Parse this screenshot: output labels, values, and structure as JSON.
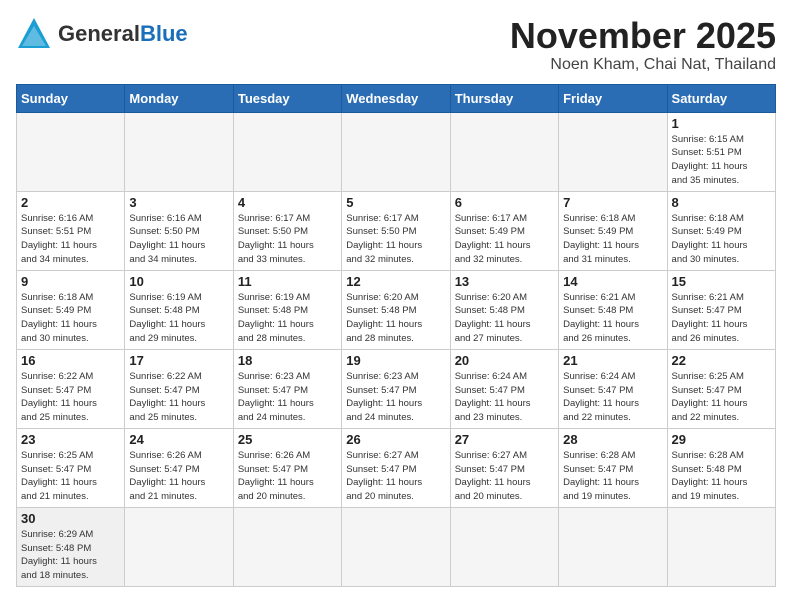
{
  "header": {
    "logo_general": "General",
    "logo_blue": "Blue",
    "month_title": "November 2025",
    "location": "Noen Kham, Chai Nat, Thailand"
  },
  "days_of_week": [
    "Sunday",
    "Monday",
    "Tuesday",
    "Wednesday",
    "Thursday",
    "Friday",
    "Saturday"
  ],
  "weeks": [
    [
      {
        "day": "",
        "info": ""
      },
      {
        "day": "",
        "info": ""
      },
      {
        "day": "",
        "info": ""
      },
      {
        "day": "",
        "info": ""
      },
      {
        "day": "",
        "info": ""
      },
      {
        "day": "",
        "info": ""
      },
      {
        "day": "1",
        "info": "Sunrise: 6:15 AM\nSunset: 5:51 PM\nDaylight: 11 hours\nand 35 minutes."
      }
    ],
    [
      {
        "day": "2",
        "info": "Sunrise: 6:16 AM\nSunset: 5:51 PM\nDaylight: 11 hours\nand 34 minutes."
      },
      {
        "day": "3",
        "info": "Sunrise: 6:16 AM\nSunset: 5:50 PM\nDaylight: 11 hours\nand 34 minutes."
      },
      {
        "day": "4",
        "info": "Sunrise: 6:17 AM\nSunset: 5:50 PM\nDaylight: 11 hours\nand 33 minutes."
      },
      {
        "day": "5",
        "info": "Sunrise: 6:17 AM\nSunset: 5:50 PM\nDaylight: 11 hours\nand 32 minutes."
      },
      {
        "day": "6",
        "info": "Sunrise: 6:17 AM\nSunset: 5:49 PM\nDaylight: 11 hours\nand 32 minutes."
      },
      {
        "day": "7",
        "info": "Sunrise: 6:18 AM\nSunset: 5:49 PM\nDaylight: 11 hours\nand 31 minutes."
      },
      {
        "day": "8",
        "info": "Sunrise: 6:18 AM\nSunset: 5:49 PM\nDaylight: 11 hours\nand 30 minutes."
      }
    ],
    [
      {
        "day": "9",
        "info": "Sunrise: 6:18 AM\nSunset: 5:49 PM\nDaylight: 11 hours\nand 30 minutes."
      },
      {
        "day": "10",
        "info": "Sunrise: 6:19 AM\nSunset: 5:48 PM\nDaylight: 11 hours\nand 29 minutes."
      },
      {
        "day": "11",
        "info": "Sunrise: 6:19 AM\nSunset: 5:48 PM\nDaylight: 11 hours\nand 28 minutes."
      },
      {
        "day": "12",
        "info": "Sunrise: 6:20 AM\nSunset: 5:48 PM\nDaylight: 11 hours\nand 28 minutes."
      },
      {
        "day": "13",
        "info": "Sunrise: 6:20 AM\nSunset: 5:48 PM\nDaylight: 11 hours\nand 27 minutes."
      },
      {
        "day": "14",
        "info": "Sunrise: 6:21 AM\nSunset: 5:48 PM\nDaylight: 11 hours\nand 26 minutes."
      },
      {
        "day": "15",
        "info": "Sunrise: 6:21 AM\nSunset: 5:47 PM\nDaylight: 11 hours\nand 26 minutes."
      }
    ],
    [
      {
        "day": "16",
        "info": "Sunrise: 6:22 AM\nSunset: 5:47 PM\nDaylight: 11 hours\nand 25 minutes."
      },
      {
        "day": "17",
        "info": "Sunrise: 6:22 AM\nSunset: 5:47 PM\nDaylight: 11 hours\nand 25 minutes."
      },
      {
        "day": "18",
        "info": "Sunrise: 6:23 AM\nSunset: 5:47 PM\nDaylight: 11 hours\nand 24 minutes."
      },
      {
        "day": "19",
        "info": "Sunrise: 6:23 AM\nSunset: 5:47 PM\nDaylight: 11 hours\nand 24 minutes."
      },
      {
        "day": "20",
        "info": "Sunrise: 6:24 AM\nSunset: 5:47 PM\nDaylight: 11 hours\nand 23 minutes."
      },
      {
        "day": "21",
        "info": "Sunrise: 6:24 AM\nSunset: 5:47 PM\nDaylight: 11 hours\nand 22 minutes."
      },
      {
        "day": "22",
        "info": "Sunrise: 6:25 AM\nSunset: 5:47 PM\nDaylight: 11 hours\nand 22 minutes."
      }
    ],
    [
      {
        "day": "23",
        "info": "Sunrise: 6:25 AM\nSunset: 5:47 PM\nDaylight: 11 hours\nand 21 minutes."
      },
      {
        "day": "24",
        "info": "Sunrise: 6:26 AM\nSunset: 5:47 PM\nDaylight: 11 hours\nand 21 minutes."
      },
      {
        "day": "25",
        "info": "Sunrise: 6:26 AM\nSunset: 5:47 PM\nDaylight: 11 hours\nand 20 minutes."
      },
      {
        "day": "26",
        "info": "Sunrise: 6:27 AM\nSunset: 5:47 PM\nDaylight: 11 hours\nand 20 minutes."
      },
      {
        "day": "27",
        "info": "Sunrise: 6:27 AM\nSunset: 5:47 PM\nDaylight: 11 hours\nand 20 minutes."
      },
      {
        "day": "28",
        "info": "Sunrise: 6:28 AM\nSunset: 5:47 PM\nDaylight: 11 hours\nand 19 minutes."
      },
      {
        "day": "29",
        "info": "Sunrise: 6:28 AM\nSunset: 5:48 PM\nDaylight: 11 hours\nand 19 minutes."
      }
    ],
    [
      {
        "day": "30",
        "info": "Sunrise: 6:29 AM\nSunset: 5:48 PM\nDaylight: 11 hours\nand 18 minutes."
      },
      {
        "day": "",
        "info": ""
      },
      {
        "day": "",
        "info": ""
      },
      {
        "day": "",
        "info": ""
      },
      {
        "day": "",
        "info": ""
      },
      {
        "day": "",
        "info": ""
      },
      {
        "day": "",
        "info": ""
      }
    ]
  ]
}
